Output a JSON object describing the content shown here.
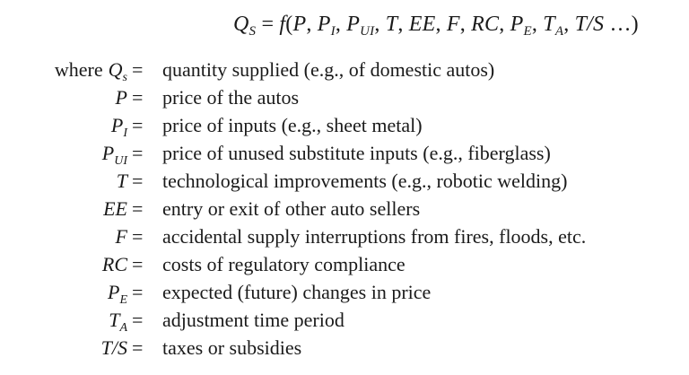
{
  "equation": {
    "lhs": "Q",
    "lhs_sub": "S",
    "equals": " = ",
    "func": "f",
    "open": "(",
    "args": [
      {
        "base": "P",
        "sub": "",
        "sep": ", "
      },
      {
        "base": "P",
        "sub": "I",
        "sep": ", "
      },
      {
        "base": "P",
        "sub": "UI",
        "sep": ", "
      },
      {
        "base": "T",
        "sub": "",
        "sep": ", "
      },
      {
        "base": "EE",
        "sub": "",
        "sep": ", "
      },
      {
        "base": "F",
        "sub": "",
        "sep": ", "
      },
      {
        "base": "RC",
        "sub": "",
        "sep": ", "
      },
      {
        "base": "P",
        "sub": "E",
        "sep": ", "
      },
      {
        "base": "T",
        "sub": "A",
        "sep": ", "
      },
      {
        "base": "T/S",
        "sub": "",
        "sep": " …"
      }
    ],
    "close": ")"
  },
  "where_label": "where",
  "equals_sign": "=",
  "definitions": [
    {
      "symbol": "Q",
      "sub": "s",
      "text": "quantity supplied (e.g., of domestic autos)"
    },
    {
      "symbol": "P",
      "sub": "",
      "text": "price of the autos"
    },
    {
      "symbol": "P",
      "sub": "I",
      "text": "price of inputs (e.g., sheet metal)"
    },
    {
      "symbol": "P",
      "sub": "UI",
      "text": "price of unused substitute inputs (e.g., fiberglass)"
    },
    {
      "symbol": "T",
      "sub": "",
      "text": "technological improvements (e.g., robotic welding)"
    },
    {
      "symbol": "EE",
      "sub": "",
      "text": "entry or exit of other auto sellers"
    },
    {
      "symbol": "F",
      "sub": "",
      "text": "accidental supply interruptions from fires, floods, etc."
    },
    {
      "symbol": "RC",
      "sub": "",
      "text": "costs of regulatory compliance"
    },
    {
      "symbol": "P",
      "sub": "E",
      "text": "expected (future) changes in price"
    },
    {
      "symbol": "T",
      "sub": "A",
      "text": "adjustment time period"
    },
    {
      "symbol": "T/S",
      "sub": "",
      "text": "taxes or subsidies"
    }
  ]
}
